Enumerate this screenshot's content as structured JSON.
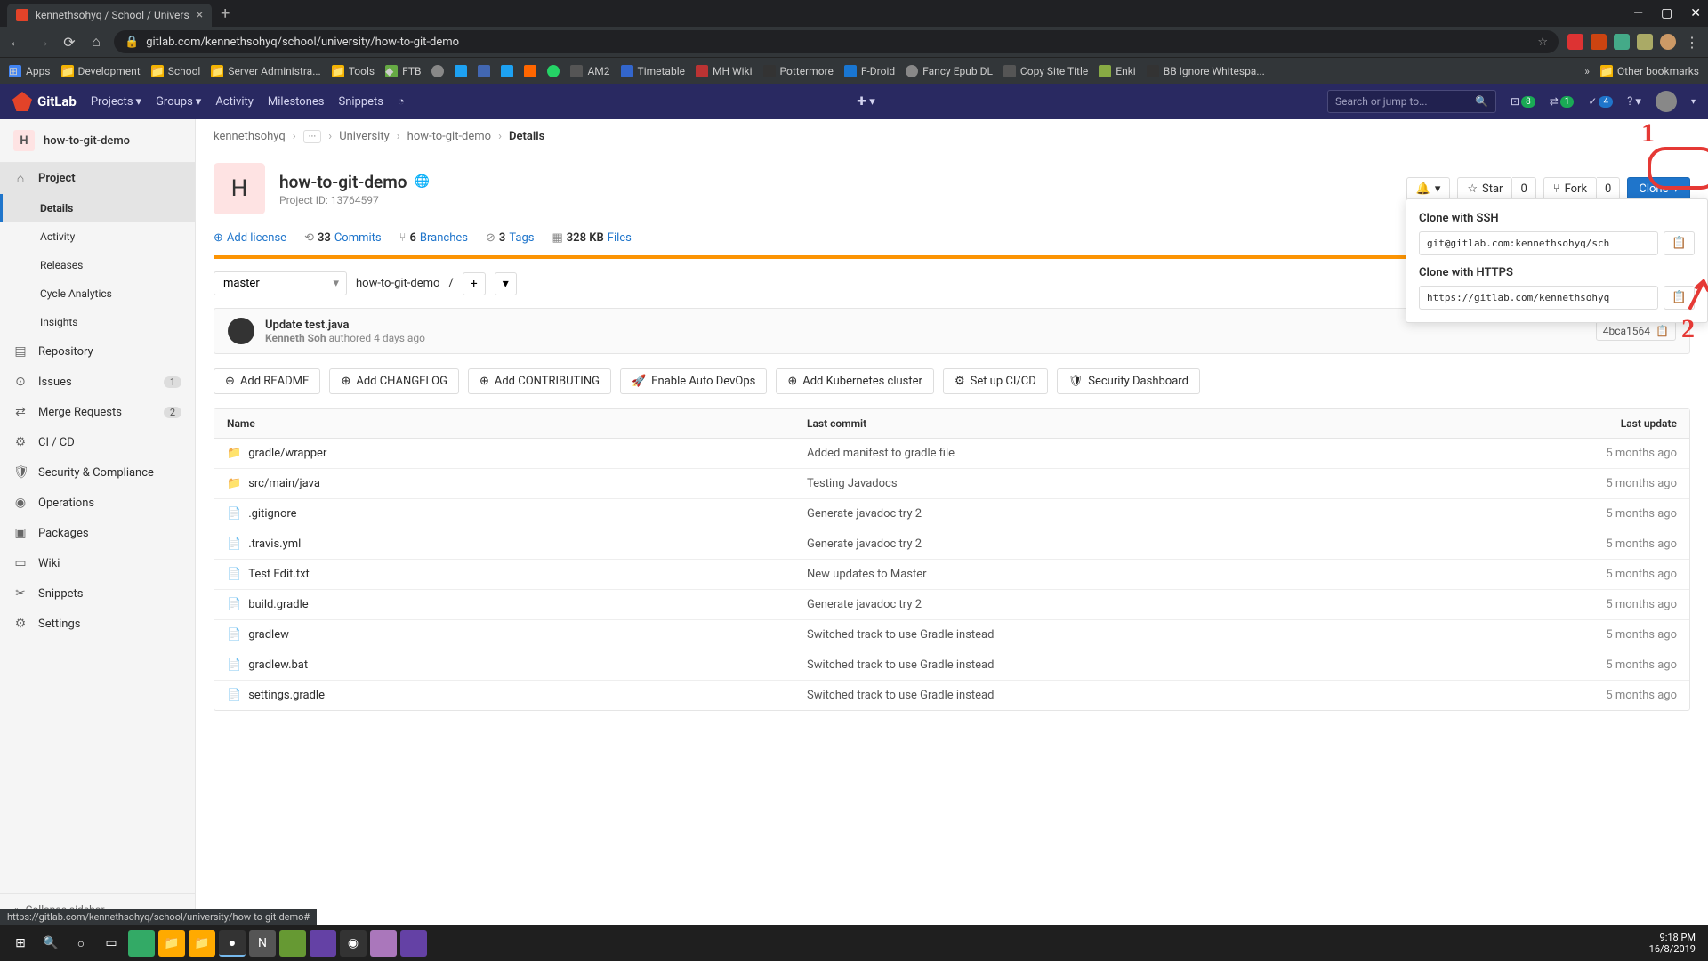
{
  "browser": {
    "tab_title": "kennethsohyq / School / Univers",
    "url": "gitlab.com/kennethsohyq/school/university/how-to-git-demo",
    "bookmarks": [
      "Apps",
      "Development",
      "School",
      "Server Administra...",
      "Tools",
      "FTB",
      "",
      "",
      "",
      "",
      "",
      "AM2",
      "Timetable",
      "MH Wiki",
      "Pottermore",
      "F-Droid",
      "Fancy Epub DL",
      "Copy Site Title",
      "Enki",
      "BB Ignore Whitespa..."
    ],
    "other_bookmarks": "Other bookmarks",
    "status_url": "https://gitlab.com/kennethsohyq/school/university/how-to-git-demo#"
  },
  "gitlab_header": {
    "brand": "GitLab",
    "nav": [
      "Projects",
      "Groups",
      "Activity",
      "Milestones",
      "Snippets"
    ],
    "search_placeholder": "Search or jump to...",
    "issues_badge": "8",
    "mr_badge": "1",
    "todo_badge": "4"
  },
  "sidebar": {
    "header_letter": "H",
    "header_name": "how-to-git-demo",
    "items": [
      {
        "icon": "⌂",
        "label": "Project",
        "active": true
      },
      {
        "label": "Details",
        "sub": true,
        "active": true
      },
      {
        "label": "Activity",
        "sub": true
      },
      {
        "label": "Releases",
        "sub": true
      },
      {
        "label": "Cycle Analytics",
        "sub": true
      },
      {
        "label": "Insights",
        "sub": true
      },
      {
        "icon": "▤",
        "label": "Repository"
      },
      {
        "icon": "⊙",
        "label": "Issues",
        "count": "1"
      },
      {
        "icon": "⇄",
        "label": "Merge Requests",
        "count": "2"
      },
      {
        "icon": "⚙",
        "label": "CI / CD"
      },
      {
        "icon": "🛡",
        "label": "Security & Compliance"
      },
      {
        "icon": "◉",
        "label": "Operations"
      },
      {
        "icon": "▣",
        "label": "Packages"
      },
      {
        "icon": "▭",
        "label": "Wiki"
      },
      {
        "icon": "✂",
        "label": "Snippets"
      },
      {
        "icon": "⚙",
        "label": "Settings"
      }
    ],
    "collapse": "Collapse sidebar"
  },
  "breadcrumbs": [
    "kennethsohyq",
    "···",
    "University",
    "how-to-git-demo",
    "Details"
  ],
  "project": {
    "avatar_letter": "H",
    "name": "how-to-git-demo",
    "id_label": "Project ID: 13764597",
    "bell_icon": "🔔",
    "star_label": "Star",
    "star_count": "0",
    "fork_label": "Fork",
    "fork_count": "0",
    "clone_label": "Clone"
  },
  "stats": {
    "add_license": "Add license",
    "items": [
      {
        "icon": "⟲",
        "num": "33",
        "label": "Commits"
      },
      {
        "icon": "⑂",
        "num": "6",
        "label": "Branches"
      },
      {
        "icon": "⊘",
        "num": "3",
        "label": "Tags"
      },
      {
        "icon": "▦",
        "num": "328 KB",
        "label": "Files"
      }
    ]
  },
  "branch": {
    "selected": "master",
    "crumb": "how-to-git-demo",
    "sep": "/"
  },
  "commit": {
    "title": "Update test.java",
    "author": "Kenneth Soh",
    "verb": "authored",
    "time": "4 days ago",
    "sha": "4bca1564"
  },
  "quick_actions": [
    "Add README",
    "Add CHANGELOG",
    "Add CONTRIBUTING",
    "Enable Auto DevOps",
    "Add Kubernetes cluster",
    "Set up CI/CD",
    "Security Dashboard"
  ],
  "files": {
    "col_name": "Name",
    "col_commit": "Last commit",
    "col_update": "Last update",
    "rows": [
      {
        "type": "dir",
        "name": "gradle/wrapper",
        "commit": "Added manifest to gradle file",
        "update": "5 months ago"
      },
      {
        "type": "dir",
        "name": "src/main/java",
        "commit": "Testing Javadocs",
        "update": "5 months ago"
      },
      {
        "type": "file",
        "name": ".gitignore",
        "commit": "Generate javadoc try 2",
        "update": "5 months ago"
      },
      {
        "type": "file",
        "name": ".travis.yml",
        "commit": "Generate javadoc try 2",
        "update": "5 months ago"
      },
      {
        "type": "file",
        "name": "Test Edit.txt",
        "commit": "New updates to Master",
        "update": "5 months ago"
      },
      {
        "type": "file",
        "name": "build.gradle",
        "commit": "Generate javadoc try 2",
        "update": "5 months ago"
      },
      {
        "type": "file",
        "name": "gradlew",
        "commit": "Switched track to use Gradle instead",
        "update": "5 months ago"
      },
      {
        "type": "file",
        "name": "gradlew.bat",
        "commit": "Switched track to use Gradle instead",
        "update": "5 months ago"
      },
      {
        "type": "file",
        "name": "settings.gradle",
        "commit": "Switched track to use Gradle instead",
        "update": "5 months ago"
      }
    ]
  },
  "clone_dropdown": {
    "ssh_label": "Clone with SSH",
    "ssh_url": "git@gitlab.com:kennethsohyq/sch",
    "https_label": "Clone with HTTPS",
    "https_url": "https://gitlab.com/kennethsohyq"
  },
  "annotations": {
    "num1": "1",
    "num2": "2"
  },
  "taskbar": {
    "time": "9:18 PM",
    "date": "16/8/2019"
  }
}
